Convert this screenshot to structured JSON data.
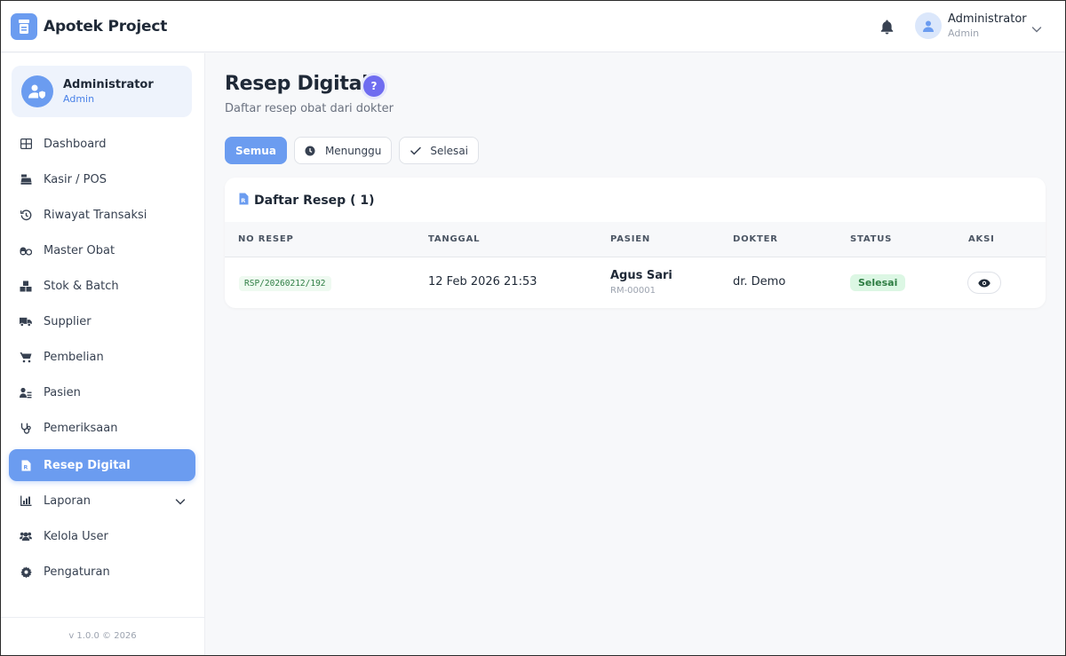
{
  "brand": {
    "name": "Apotek Project",
    "logo_icon": "pill-bottle-icon",
    "accent": "#6b9cf0"
  },
  "header": {
    "user_name": "Administrator",
    "user_role": "Admin"
  },
  "sidebar": {
    "profile": {
      "name": "Administrator",
      "role": "Admin"
    },
    "items": [
      {
        "label": "Dashboard",
        "icon": "grid-icon"
      },
      {
        "label": "Kasir / POS",
        "icon": "cash-register-icon"
      },
      {
        "label": "Riwayat Transaksi",
        "icon": "history-icon"
      },
      {
        "label": "Master Obat",
        "icon": "pills-icon"
      },
      {
        "label": "Stok & Batch",
        "icon": "boxes-icon"
      },
      {
        "label": "Supplier",
        "icon": "truck-icon"
      },
      {
        "label": "Pembelian",
        "icon": "cart-icon"
      },
      {
        "label": "Pasien",
        "icon": "patient-card-icon"
      },
      {
        "label": "Pemeriksaan",
        "icon": "stethoscope-icon"
      },
      {
        "label": "Resep Digital",
        "icon": "prescription-icon",
        "active": true
      },
      {
        "label": "Laporan",
        "icon": "chart-icon",
        "has_submenu": true
      },
      {
        "label": "Kelola User",
        "icon": "users-icon"
      },
      {
        "label": "Pengaturan",
        "icon": "gear-icon"
      }
    ],
    "footer": "v 1.0.0 © 2026"
  },
  "page": {
    "title": "Resep Digital",
    "help": "?",
    "subtitle": "Daftar resep obat dari dokter"
  },
  "filters": [
    {
      "label": "Semua",
      "active": true
    },
    {
      "label": "Menunggu",
      "icon": "clock-icon"
    },
    {
      "label": "Selesai",
      "icon": "check-icon"
    }
  ],
  "table": {
    "title": "Daftar Resep ( 1)",
    "columns": [
      "NO RESEP",
      "TANGGAL",
      "PASIEN",
      "DOKTER",
      "STATUS",
      "AKSI"
    ],
    "rows": [
      {
        "no_resep": "RSP/20260212/192",
        "tanggal": "12 Feb 2026 21:53",
        "pasien_nama": "Agus Sari",
        "pasien_id": "RM-00001",
        "dokter": "dr. Demo",
        "status": "Selesai",
        "status_color": "#2e7d43"
      }
    ]
  }
}
